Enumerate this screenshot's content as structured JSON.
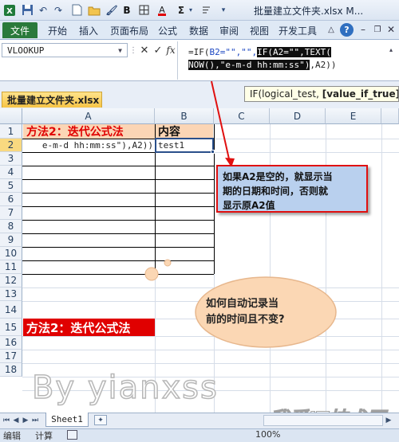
{
  "window": {
    "title": "批量建立文件夹.xlsx M...",
    "qat_icons": [
      "excel-icon",
      "save-icon",
      "undo-icon",
      "redo-icon",
      "new-icon",
      "open-icon",
      "bold-icon",
      "sum-icon",
      "format-icon"
    ]
  },
  "ribbon": {
    "file_label": "文件",
    "tabs": [
      "开始",
      "插入",
      "页面布局",
      "公式",
      "数据",
      "审阅",
      "视图",
      "开发工具"
    ],
    "help": "?"
  },
  "formula_bar": {
    "name_box": "VLOOKUP",
    "cancel": "✕",
    "enter": "✓",
    "fx": "fx",
    "line1_a": "=IF(",
    "line1_b": "B2=\"\",\"\",",
    "line1_c": "IF(A2=\"\",TEXT(",
    "line2_a": "NOW(),\"e-m-d hh:mm:ss\")",
    "line2_b": ",A2))"
  },
  "workbook": {
    "tab_name": "批量建立文件夹.xlsx",
    "tooltip_plain": "IF(logical_test, ",
    "tooltip_bold": "[value_if_true]"
  },
  "grid": {
    "columns": [
      "A",
      "B",
      "C",
      "D",
      "E"
    ],
    "rows": [
      "1",
      "2",
      "3",
      "4",
      "5",
      "6",
      "7",
      "8",
      "9",
      "10",
      "11",
      "12",
      "13",
      "14",
      "15",
      "16",
      "17",
      "18"
    ],
    "cells": {
      "A1": "方法2：迭代公式法",
      "B1": "内容",
      "A2": "e-m-d hh:mm:ss\"),A2))",
      "B2": "test1",
      "A15": "方法2：迭代公式法"
    }
  },
  "callouts": {
    "box_line1": "如果A2是空的，就显示当",
    "box_line2": "期的日期和时间，否则就",
    "box_line3": "显示原A2值",
    "cloud_line1": "如何自动记录当",
    "cloud_line2": "前的时间且不变?"
  },
  "watermarks": {
    "left": "By yianxss",
    "right": "我爱IT技术网"
  },
  "sheets": {
    "active": "Sheet1"
  },
  "status": {
    "mode": "编辑",
    "calc": "计算",
    "zoom": "100%"
  },
  "colors": {
    "file_tab": "#2a7a3b",
    "header_fill": "#fbd5b5",
    "red": "#e00000",
    "callout_fill": "#b9d0ee",
    "cloud_fill": "#fbd7b4",
    "selection": "#2a4f8a"
  }
}
